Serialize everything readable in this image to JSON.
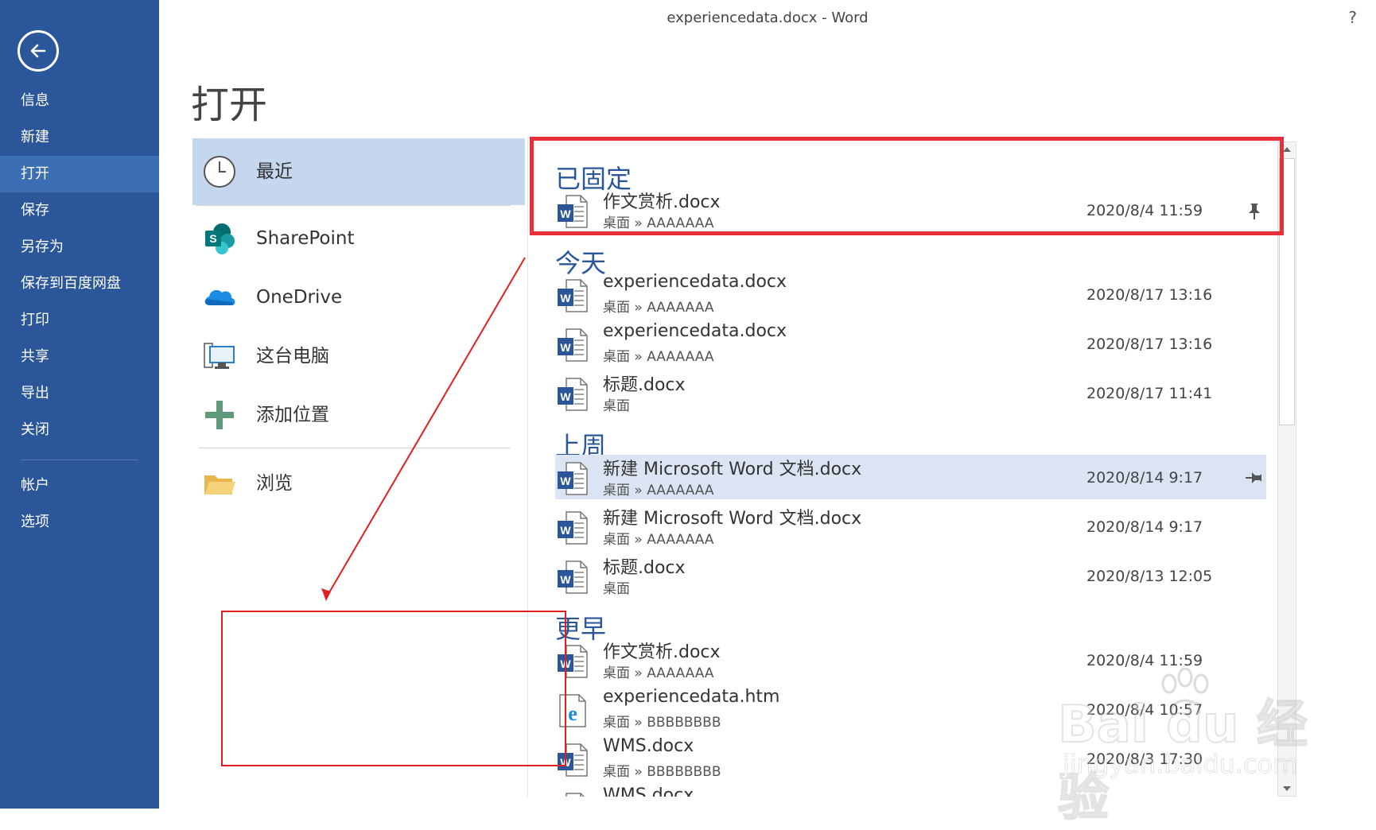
{
  "window": {
    "title": "experiencedata.docx - Word",
    "help": "?"
  },
  "nav": {
    "items": [
      {
        "label": "信息"
      },
      {
        "label": "新建"
      },
      {
        "label": "打开"
      },
      {
        "label": "保存"
      },
      {
        "label": "另存为"
      },
      {
        "label": "保存到百度网盘"
      },
      {
        "label": "打印"
      },
      {
        "label": "共享"
      },
      {
        "label": "导出"
      },
      {
        "label": "关闭"
      },
      {
        "label": "帐户"
      },
      {
        "label": "选项"
      }
    ],
    "active": "打开"
  },
  "page": {
    "title": "打开"
  },
  "places": [
    {
      "label": "最近",
      "icon": "clock-icon"
    },
    {
      "label": "SharePoint",
      "icon": "sharepoint-icon"
    },
    {
      "label": "OneDrive",
      "icon": "onedrive-icon"
    },
    {
      "label": "这台电脑",
      "icon": "computer-icon"
    },
    {
      "label": "添加位置",
      "icon": "add-icon"
    },
    {
      "label": "浏览",
      "icon": "folder-icon"
    }
  ],
  "groups": [
    {
      "heading": "已固定",
      "files": [
        {
          "name": "作文赏析.docx",
          "path": "桌面 » AAAAAAA",
          "date": "2020/8/4 11:59",
          "type": "word",
          "pinned": true
        }
      ]
    },
    {
      "heading": "今天",
      "files": [
        {
          "name": "experiencedata.docx",
          "path": "桌面 » AAAAAAA",
          "date": "2020/8/17 13:16",
          "type": "word"
        },
        {
          "name": "experiencedata.docx",
          "path": "桌面 » AAAAAAA",
          "date": "2020/8/17 13:16",
          "type": "word"
        },
        {
          "name": "标题.docx",
          "path": "桌面",
          "date": "2020/8/17 11:41",
          "type": "word"
        }
      ]
    },
    {
      "heading": "上周",
      "files": [
        {
          "name": "新建 Microsoft Word 文档.docx",
          "path": "桌面 » AAAAAAA",
          "date": "2020/8/14 9:17",
          "type": "word",
          "highlighted": true
        },
        {
          "name": "新建 Microsoft Word 文档.docx",
          "path": "桌面 » AAAAAAA",
          "date": "2020/8/14 9:17",
          "type": "word"
        },
        {
          "name": "标题.docx",
          "path": "桌面",
          "date": "2020/8/13 12:05",
          "type": "word"
        }
      ]
    },
    {
      "heading": "更早",
      "files": [
        {
          "name": "作文赏析.docx",
          "path": "桌面 » AAAAAAA",
          "date": "2020/8/4 11:59",
          "type": "word"
        },
        {
          "name": "experiencedata.htm",
          "path": "桌面 » BBBBBBBB",
          "date": "2020/8/4 10:57",
          "type": "edge"
        },
        {
          "name": "WMS.docx",
          "path": "桌面 » BBBBBBBB",
          "date": "2020/8/3 17:30",
          "type": "word"
        },
        {
          "name": "WMS.docx",
          "path": "",
          "date": "",
          "type": "word"
        }
      ]
    }
  ],
  "watermark": {
    "main": "Bai du 经验",
    "sub": "jingyan.baidu.com"
  },
  "colors": {
    "nav_bg": "#2b579a",
    "accent": "#2b579a",
    "annotation": "#e8303a",
    "selected": "#c5d6ef"
  }
}
